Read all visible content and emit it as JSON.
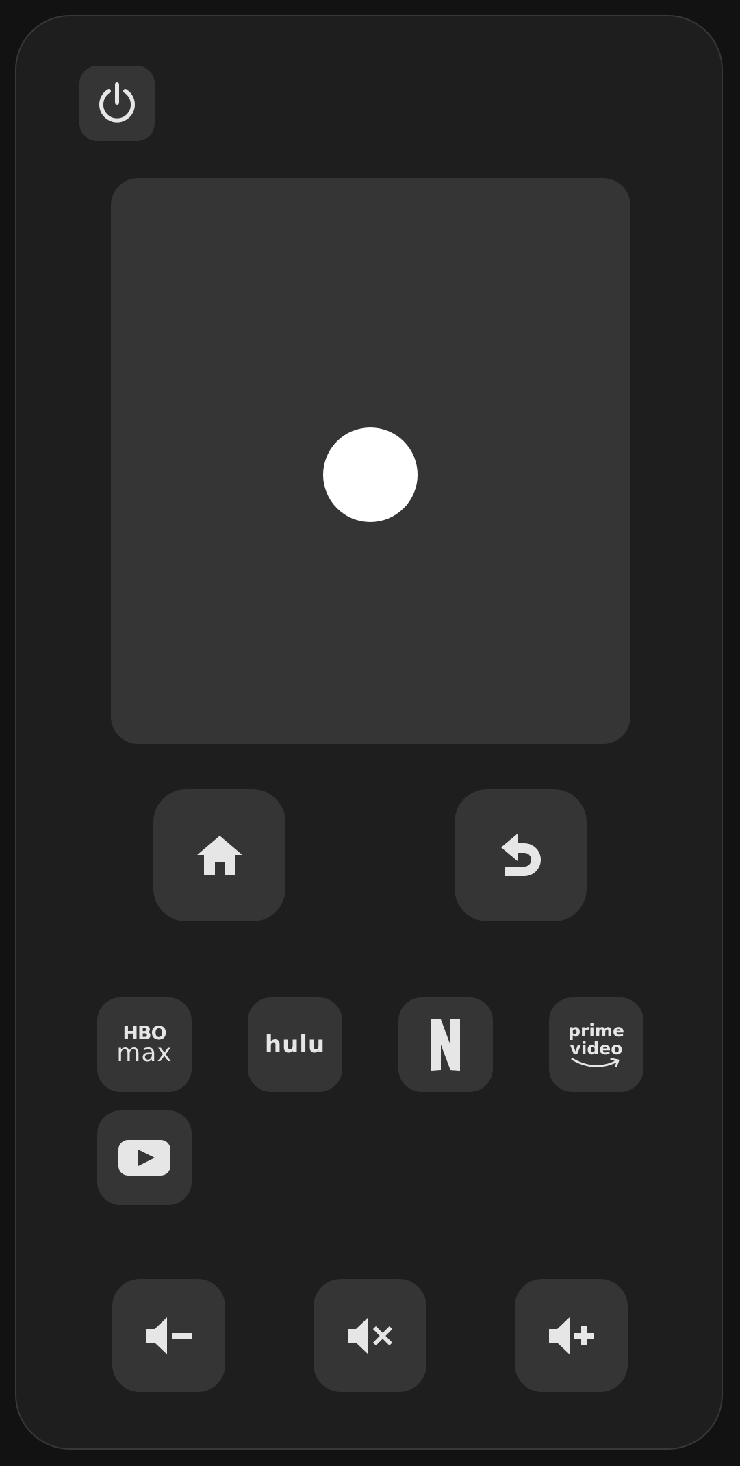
{
  "apps": {
    "hbo": {
      "line1": "HBO",
      "line2": "max"
    },
    "hulu": {
      "label": "hulu"
    },
    "prime": {
      "line1": "prime",
      "line2": "video"
    }
  },
  "colors": {
    "background": "#121212",
    "remote_body": "#1e1e1e",
    "button": "#353535",
    "icon": "#e6e6e6",
    "cursor": "#ffffff"
  },
  "icons": {
    "power": "power-icon",
    "home": "home-icon",
    "back": "back-arrow-icon",
    "netflix": "netflix-logo-icon",
    "youtube": "youtube-logo-icon",
    "volume_down": "volume-down-icon",
    "mute": "volume-mute-icon",
    "volume_up": "volume-up-icon"
  }
}
